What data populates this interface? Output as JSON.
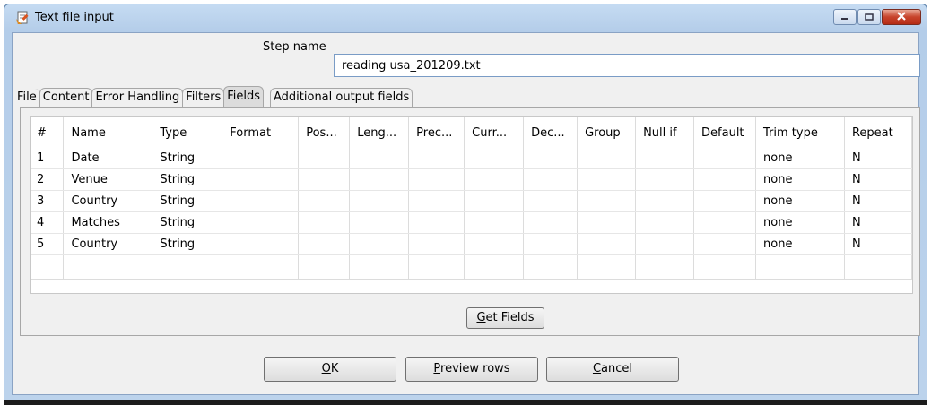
{
  "window": {
    "title": "Text file input"
  },
  "form": {
    "step_name_label": "Step name",
    "step_name_value": "reading usa_201209.txt"
  },
  "tabs": [
    {
      "label": "File"
    },
    {
      "label": "Content"
    },
    {
      "label": "Error Handling"
    },
    {
      "label": "Filters"
    },
    {
      "label": "Fields",
      "active": true
    },
    {
      "label": "Additional output fields"
    }
  ],
  "table": {
    "columns": [
      "#",
      "Name",
      "Type",
      "Format",
      "Pos...",
      "Leng...",
      "Prec...",
      "Curr...",
      "Dec...",
      "Group",
      "Null if",
      "Default",
      "Trim type",
      "Repeat"
    ],
    "rows": [
      [
        "1",
        "Date",
        "String",
        "",
        "",
        "",
        "",
        "",
        "",
        "",
        "",
        "",
        "none",
        "N"
      ],
      [
        "2",
        "Venue",
        "String",
        "",
        "",
        "",
        "",
        "",
        "",
        "",
        "",
        "",
        "none",
        "N"
      ],
      [
        "3",
        "Country",
        "String",
        "",
        "",
        "",
        "",
        "",
        "",
        "",
        "",
        "",
        "none",
        "N"
      ],
      [
        "4",
        "Matches",
        "String",
        "",
        "",
        "",
        "",
        "",
        "",
        "",
        "",
        "",
        "none",
        "N"
      ],
      [
        "5",
        "Country",
        "String",
        "",
        "",
        "",
        "",
        "",
        "",
        "",
        "",
        "",
        "none",
        "N"
      ]
    ]
  },
  "buttons": {
    "get_fields": {
      "mnemonic": "G",
      "rest": "et Fields"
    },
    "ok": {
      "mnemonic": "O",
      "rest": "K"
    },
    "preview": {
      "mnemonic": "P",
      "rest": "review rows"
    },
    "cancel": {
      "mnemonic": "C",
      "rest": "ancel"
    }
  },
  "icons": {
    "title": "text-file-input-step-icon",
    "minimize": "minimize-icon",
    "maximize": "maximize-icon",
    "close": "close-icon"
  },
  "colors": {
    "titlebar": "#c5dbf2",
    "close_button": "#c7432b",
    "dialog_bg": "#f0f0f0"
  }
}
